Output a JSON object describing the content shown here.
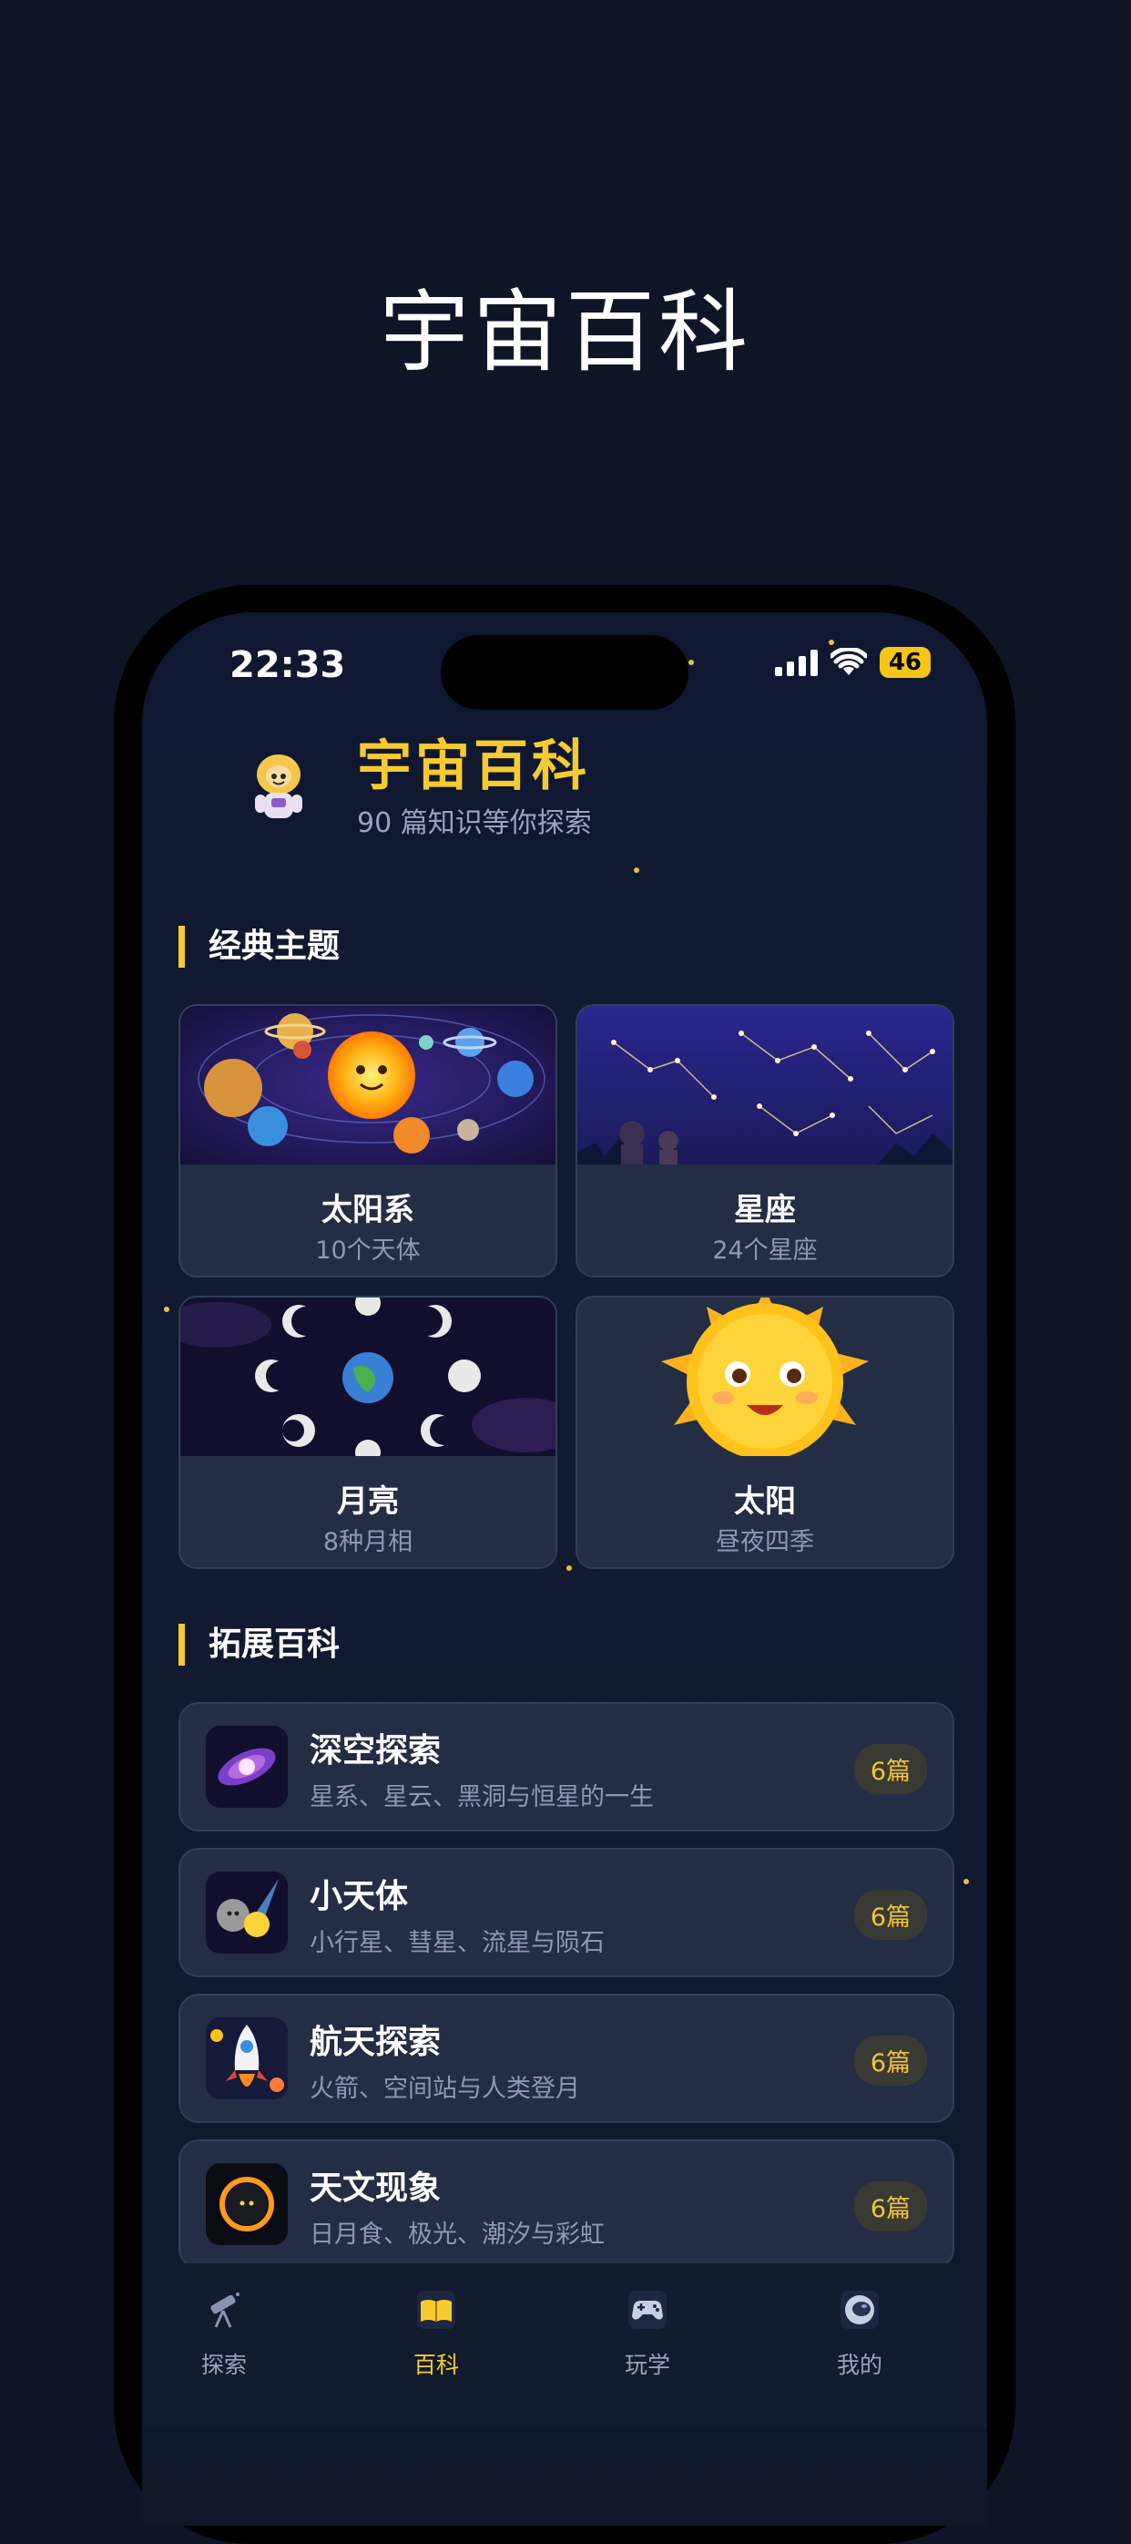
{
  "promo": {
    "headline": "宇宙百科"
  },
  "status_bar": {
    "time": "22:33",
    "battery": "46"
  },
  "header": {
    "title": "宇宙百科",
    "subtitle": "90 篇知识等你探索",
    "icon": "astronaut-icon"
  },
  "classic": {
    "title": "经典主题",
    "cards": [
      {
        "name": "太阳系",
        "sub": "10个天体"
      },
      {
        "name": "星座",
        "sub": "24个星座"
      },
      {
        "name": "月亮",
        "sub": "8种月相"
      },
      {
        "name": "太阳",
        "sub": "昼夜四季"
      }
    ]
  },
  "extended": {
    "title": "拓展百科",
    "items": [
      {
        "title": "深空探索",
        "desc": "星系、星云、黑洞与恒星的一生",
        "count": "6篇"
      },
      {
        "title": "小天体",
        "desc": "小行星、彗星、流星与陨石",
        "count": "6篇"
      },
      {
        "title": "航天探索",
        "desc": "火箭、空间站与人类登月",
        "count": "6篇"
      },
      {
        "title": "天文现象",
        "desc": "日月食、极光、潮汐与彩虹",
        "count": "6篇"
      }
    ]
  },
  "tabbar": {
    "tabs": [
      {
        "label": "探索",
        "icon": "telescope-icon"
      },
      {
        "label": "百科",
        "icon": "book-icon"
      },
      {
        "label": "玩学",
        "icon": "gamepad-icon"
      },
      {
        "label": "我的",
        "icon": "astronaut-helmet-icon"
      }
    ],
    "active": "百科"
  },
  "colors": {
    "accent": "#f7cb2f",
    "background": "#0e1527",
    "card": "#232d44"
  }
}
